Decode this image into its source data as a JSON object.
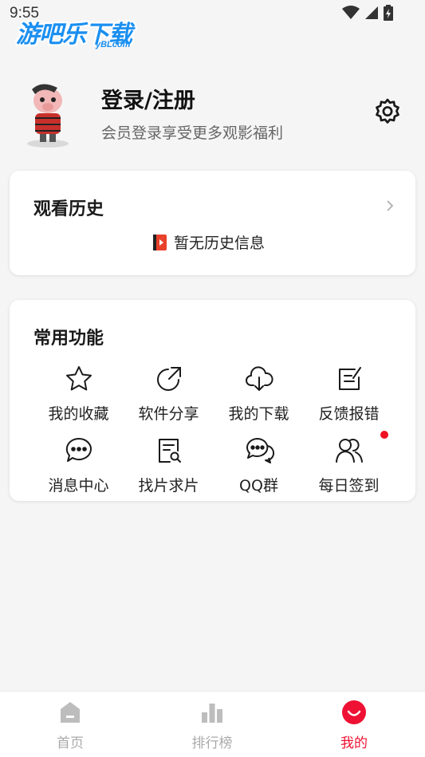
{
  "status_bar": {
    "time": "9:55",
    "watermark_main": "游吧乐下载",
    "watermark_sub": "yBLcom"
  },
  "profile": {
    "title": "登录/注册",
    "subtitle": "会员登录享受更多观影福利"
  },
  "history": {
    "title": "观看历史",
    "empty_text": "暂无历史信息"
  },
  "functions": {
    "title": "常用功能",
    "items": [
      {
        "label": "我的收藏",
        "icon": "star-icon"
      },
      {
        "label": "软件分享",
        "icon": "share-icon"
      },
      {
        "label": "我的下载",
        "icon": "cloud-download-icon"
      },
      {
        "label": "反馈报错",
        "icon": "edit-icon"
      },
      {
        "label": "消息中心",
        "icon": "message-icon"
      },
      {
        "label": "找片求片",
        "icon": "search-document-icon"
      },
      {
        "label": "QQ群",
        "icon": "chat-bubbles-icon"
      },
      {
        "label": "每日签到",
        "icon": "users-icon"
      }
    ]
  },
  "tabbar": {
    "items": [
      {
        "label": "首页",
        "icon": "home-icon"
      },
      {
        "label": "排行榜",
        "icon": "ranking-icon"
      },
      {
        "label": "我的",
        "icon": "profile-icon"
      }
    ],
    "active": "我的"
  },
  "colors": {
    "accent": "#ee1133",
    "watermark": "#1b8ff0",
    "notification_dot": "#ee1122"
  }
}
